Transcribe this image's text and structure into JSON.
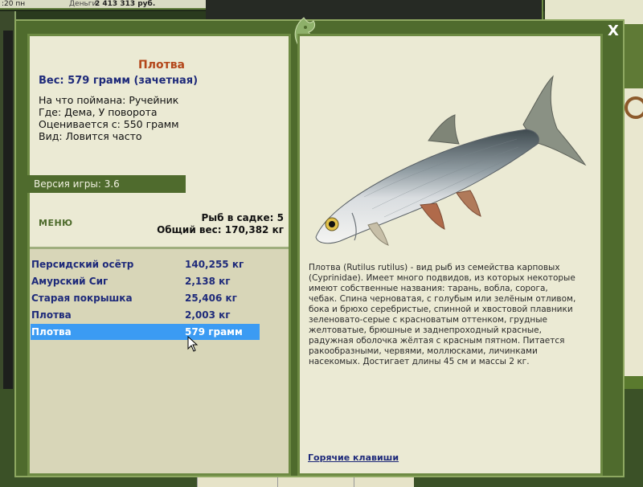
{
  "topbar": {
    "time": ":20 пн",
    "money_label": "Деньги:",
    "money_value": "2 413 313 руб."
  },
  "dialog": {
    "close_label": "X"
  },
  "fish_info": {
    "name": "Плотва",
    "weight_line": "Вес: 579 грамм (зачетная)",
    "bait": "На что поймана: Ручейник",
    "location": "Где: Дема, У поворота",
    "valued": "Оценивается с: 550 грамм",
    "kind": "Вид: Ловится часто"
  },
  "version": "Версия игры: 3.6",
  "menu_label": "МЕНЮ",
  "stats": {
    "fish_in_keepnet": "Рыб в садке: 5",
    "total_weight": "Общий вес: 170,382 кг"
  },
  "catch_list": [
    {
      "name": "Персидский осётр",
      "weight": "140,255 кг",
      "selected": false
    },
    {
      "name": "Амурский Сиг",
      "weight": "2,138 кг",
      "selected": false
    },
    {
      "name": "Старая покрышка",
      "weight": "25,406 кг",
      "selected": false
    },
    {
      "name": "Плотва",
      "weight": "2,003 кг",
      "selected": false
    },
    {
      "name": "Плотва",
      "weight": "579 грамм",
      "selected": true
    }
  ],
  "description": "Плотва (Rutilus rutilus) - вид рыб из семейства карповых (Cyprinidae). Имеет много подвидов, из которых некоторые имеют собственные названия: тарань, вобла, сорога, чебак. Спина черноватая, с голубым или зелёным отливом, бока и брюхо серебристые, спинной и хвостовой плавники зеленовато-серые с красноватым оттенком, грудные желтоватые, брюшные и заднепроходный красные, радужная оболочка жёлтая с красным пятном. Питается ракообразными, червями, моллюсками, личинками насекомых. Достигает длины 45 см и массы 2 кг.",
  "hotkeys_label": "Горячие клавиши",
  "colors": {
    "frame_green": "#4f6b2d",
    "panel_bg": "#ebead4",
    "title_red": "#b3461a",
    "link_blue": "#1e2a7a",
    "selection_blue": "#3b9bf3"
  }
}
